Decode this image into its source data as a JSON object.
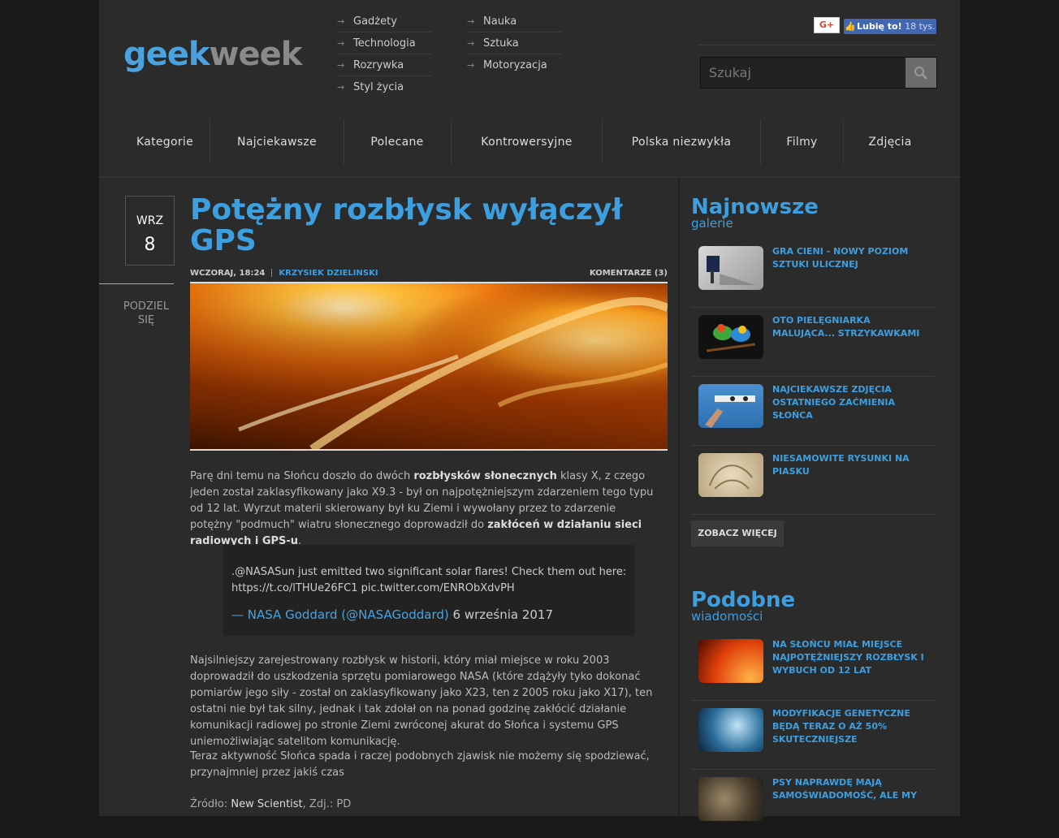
{
  "logo": {
    "geek": "geek",
    "week": "week"
  },
  "topnav": {
    "col1": [
      "Gadżety",
      "Technologia",
      "Rozrywka",
      "Styl życia"
    ],
    "col2": [
      "Nauka",
      "Sztuka",
      "Motoryzacja"
    ]
  },
  "social": {
    "gplus": "G+",
    "fb_like": "Lubię to!",
    "fb_count": "18 tys."
  },
  "search": {
    "placeholder": "Szukaj",
    "value": ""
  },
  "mainnav": [
    "Kategorie",
    "Najciekawsze",
    "Polecane",
    "Kontrowersyjne",
    "Polska niezwykła",
    "Filmy",
    "Zdjęcia"
  ],
  "article": {
    "date_month": "WRZ",
    "date_day": "8",
    "share_label_1": "PODZIEL",
    "share_label_2": "SIĘ",
    "title": "Potężny rozbłysk wyłączył GPS",
    "time": "WCZORAJ, 18:24",
    "author": "KRZYSIEK DZIELINSKI",
    "comments": "KOMENTARZE (3)",
    "p1_a": "Parę dni temu na Słońcu doszło do dwóch ",
    "p1_b": "rozbłysków słonecznych",
    "p1_c": " klasy X, z czego jeden został zaklasyfikowany jako X9.3 - był on najpotężniejszym zdarzeniem tego typu od 12 lat. Wyrzut materii skierowany był ku Ziemi i wywołany przez to zdarzenie potężny \"podmuch\" wiatru słonecznego doprowadził do ",
    "p1_d": "zakłóceń w działaniu sieci radiowych i GPS-u",
    "p1_e": ".",
    "tweet_a": ".",
    "tweet_handle": "@NASASun",
    "tweet_text": " just emitted two significant solar flares! Check them out here: ",
    "tweet_link": "https://t.co/lTHUe26FC1",
    "tweet_pic": " pic.twitter.com/ENRObXdvPH",
    "tweet_author": "— NASA Goddard (@NASAGoddard)",
    "tweet_date": " 6 września 2017",
    "p2": "Najsilniejszy zarejestrowany rozbłysk w historii, który miał miejsce w roku 2003 doprowadził do uszkodzenia sprzętu pomiarowego NASA (które zdążyły tyko dokonać pomiarów jego siły - został on zaklasyfikowany jako X23, ten z 2005 roku jako X17), ten ostatni nie był tak silny, jednak i tak zdołał on na ponad godzinę zakłócić działanie komunikacji radiowej po stronie Ziemi zwróconej akurat do Słońca i systemu GPS uniemożliwiając satelitom komunikację.",
    "p3": "Teraz aktywność Słońca spada i raczej podobnych zjawisk nie możemy się spodziewać, przynajmniej przez jakiś czas",
    "source_label": "Źródło: ",
    "source_value": "New Scientist",
    "photo_label": ", Zdj.: ",
    "photo_value": "PD"
  },
  "sidebar": {
    "galleries_title": "Najnowsze",
    "galleries_sub": "galerie",
    "galleries": [
      "GRA CIENI - NOWY POZIOM SZTUKI ULICZNEJ",
      "OTO PIELĘGNIARKA MALUJĄCA... STRZYKAWKAMI",
      "NAJCIEKAWSZE ZDJĘCIA OSTATNIEGO ZAĆMIENIA SŁOŃCA",
      "NIESAMOWITE RYSUNKI NA PIASKU"
    ],
    "more_label": "ZOBACZ WIĘCEJ",
    "similar_title": "Podobne",
    "similar_sub": "wiadomości",
    "similar": [
      "NA SŁOŃCU MIAŁ MIEJSCE NAJPOTĘŻNIEJSZY ROZBŁYSK I WYBUCH OD 12 LAT",
      "MODYFIKACJE GENETYCZNE BĘDĄ TERAZ O AŻ 50% SKUTECZNIEJSZE",
      "PSY NAPRAWDĘ MAJĄ SAMOŚWIADOMOŚĆ, ALE MY"
    ]
  },
  "colors": {
    "accent": "#3d9fe0",
    "background": "#2b2b2b",
    "outer": "#1a1a1a"
  }
}
